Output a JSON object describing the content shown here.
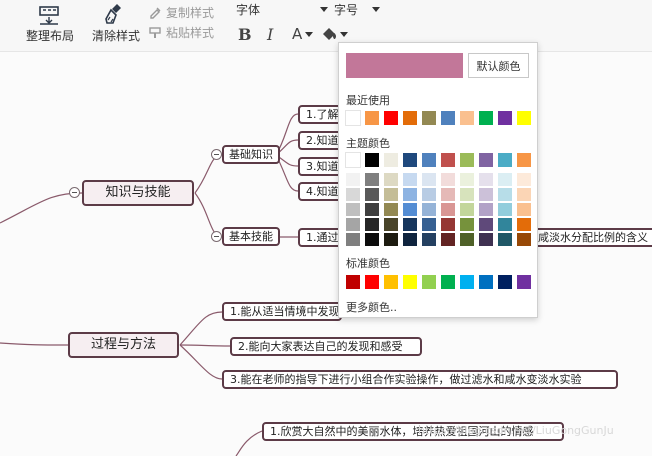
{
  "toolbar": {
    "arrange_label": "整理布局",
    "clear_style_label": "清除样式",
    "copy_style_label": "复制样式",
    "paste_style_label": "粘贴样式",
    "font_label": "字体",
    "font_size_label": "字号",
    "bold_label": "B",
    "italic_label": "I",
    "font_color_label": "A"
  },
  "mindmap": {
    "main_nodes": {
      "knowledge": "知识与技能",
      "process": "过程与方法"
    },
    "sub_nodes": {
      "basic_knowledge": "基础知识",
      "basic_skill": "基本技能"
    },
    "leaf_nodes": {
      "k1": "1.了解",
      "k2": "2.知道",
      "k3": "3.知道",
      "k4": "4.知道",
      "skill1_left": "1.通过",
      "skill1_right": "咸淡水分配比例的含义",
      "p1": "1.能从适当情境中发现",
      "p2": "2.能向大家表达自己的发现和感受",
      "p3": "3.能在老师的指导下进行小组合作实验操作，做过滤水和咸水变淡水实验",
      "e1": "1.欣赏大自然中的美丽水体，培养热爱祖国河山的情感"
    }
  },
  "color_picker": {
    "selected_color": "#c27799",
    "default_color_label": "默认颜色",
    "recent_title": "最近使用",
    "recent_colors": [
      "#ffffff",
      "#f79646",
      "#ff0000",
      "#e36c09",
      "#938953",
      "#4f81bd",
      "#fac08f",
      "#00b050",
      "#7030a0",
      "#ffff00"
    ],
    "theme_title": "主题颜色",
    "theme_top": [
      "#ffffff",
      "#000000",
      "#eeece1",
      "#1f497d",
      "#4f81bd",
      "#c0504d",
      "#9bbb59",
      "#8064a2",
      "#4bacc6",
      "#f79646"
    ],
    "theme_shades": [
      [
        "#f2f2f2",
        "#7f7f7f",
        "#ddd9c3",
        "#c6d9f0",
        "#dbe5f1",
        "#f2dcdb",
        "#ebf1dd",
        "#e5e0ec",
        "#dbeef3",
        "#fdeada"
      ],
      [
        "#d8d8d8",
        "#595959",
        "#c4bd97",
        "#8db3e2",
        "#b8cce4",
        "#e5b9b7",
        "#d7e3bc",
        "#ccc1d9",
        "#b7dde8",
        "#fbd5b5"
      ],
      [
        "#bfbfbf",
        "#3f3f3f",
        "#938953",
        "#548dd4",
        "#95b3d7",
        "#d99694",
        "#c3d69b",
        "#b2a2c7",
        "#92cddc",
        "#fac08f"
      ],
      [
        "#a5a5a5",
        "#262626",
        "#494429",
        "#17365d",
        "#366092",
        "#953734",
        "#76923c",
        "#5f497a",
        "#31859b",
        "#e36c09"
      ],
      [
        "#7f7f7f",
        "#0c0c0c",
        "#1d1b10",
        "#0f243e",
        "#244061",
        "#632423",
        "#4f6128",
        "#3f3151",
        "#205867",
        "#974806"
      ]
    ],
    "standard_title": "标准颜色",
    "standard_colors": [
      "#c00000",
      "#ff0000",
      "#ffc000",
      "#ffff00",
      "#92d050",
      "#00b050",
      "#00b0f0",
      "#0070c0",
      "#002060",
      "#7030a0"
    ],
    "more_colors_label": "更多颜色.."
  },
  "watermark": "https://blog.csdn.net/LiuGongGunJu",
  "colors": {
    "node_border": "#5c3b47",
    "main_node_fill": "#f6eef1",
    "link_color": "#8a5a6b"
  }
}
